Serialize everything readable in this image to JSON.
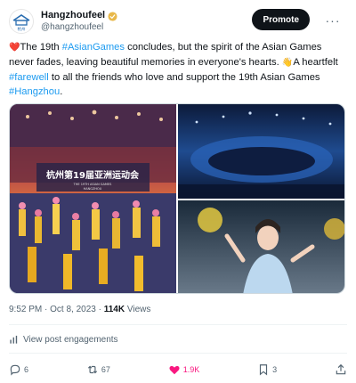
{
  "author": {
    "display_name": "Hangzhoufeel",
    "handle": "@hangzhoufeel",
    "avatar_caption": "杭州",
    "verified_icon": "verified-badge-icon"
  },
  "header": {
    "promote_label": "Promote",
    "more_icon": "more-icon",
    "more_label": "···"
  },
  "tweet": {
    "emoji_heart": "❤️",
    "seg1": "The 19th ",
    "tag_asiangames": "#AsianGames",
    "seg2": " concludes, but the spirit of the Asian Games never fades, leaving beautiful memories in everyone's hearts. ",
    "emoji_wave": "👋",
    "seg3": "A heartfelt ",
    "tag_farewell": "#farewell",
    "seg4": " to all the friends who love and support the 19th Asian Games ",
    "tag_hangzhou": "#Hangzhou",
    "seg5": "."
  },
  "media": {
    "banner_text": "杭州第19届亚洲运动会",
    "banner_subtext": "THE 19TH ASIAN GAMES",
    "banner_city": "HANGZHOU"
  },
  "meta": {
    "time": "9:52 PM",
    "sep1": " · ",
    "date": "Oct 8, 2023",
    "sep2": " · ",
    "views_count": "114K",
    "views_label": " Views"
  },
  "engagements": {
    "label": "View post engagements",
    "icon": "analytics-icon"
  },
  "actions": {
    "replies": "6",
    "reposts": "67",
    "likes": "1.9K",
    "bookmarks": "3",
    "colors": {
      "like": "#f91880",
      "muted": "#536471",
      "link": "#1d9bf0"
    }
  }
}
